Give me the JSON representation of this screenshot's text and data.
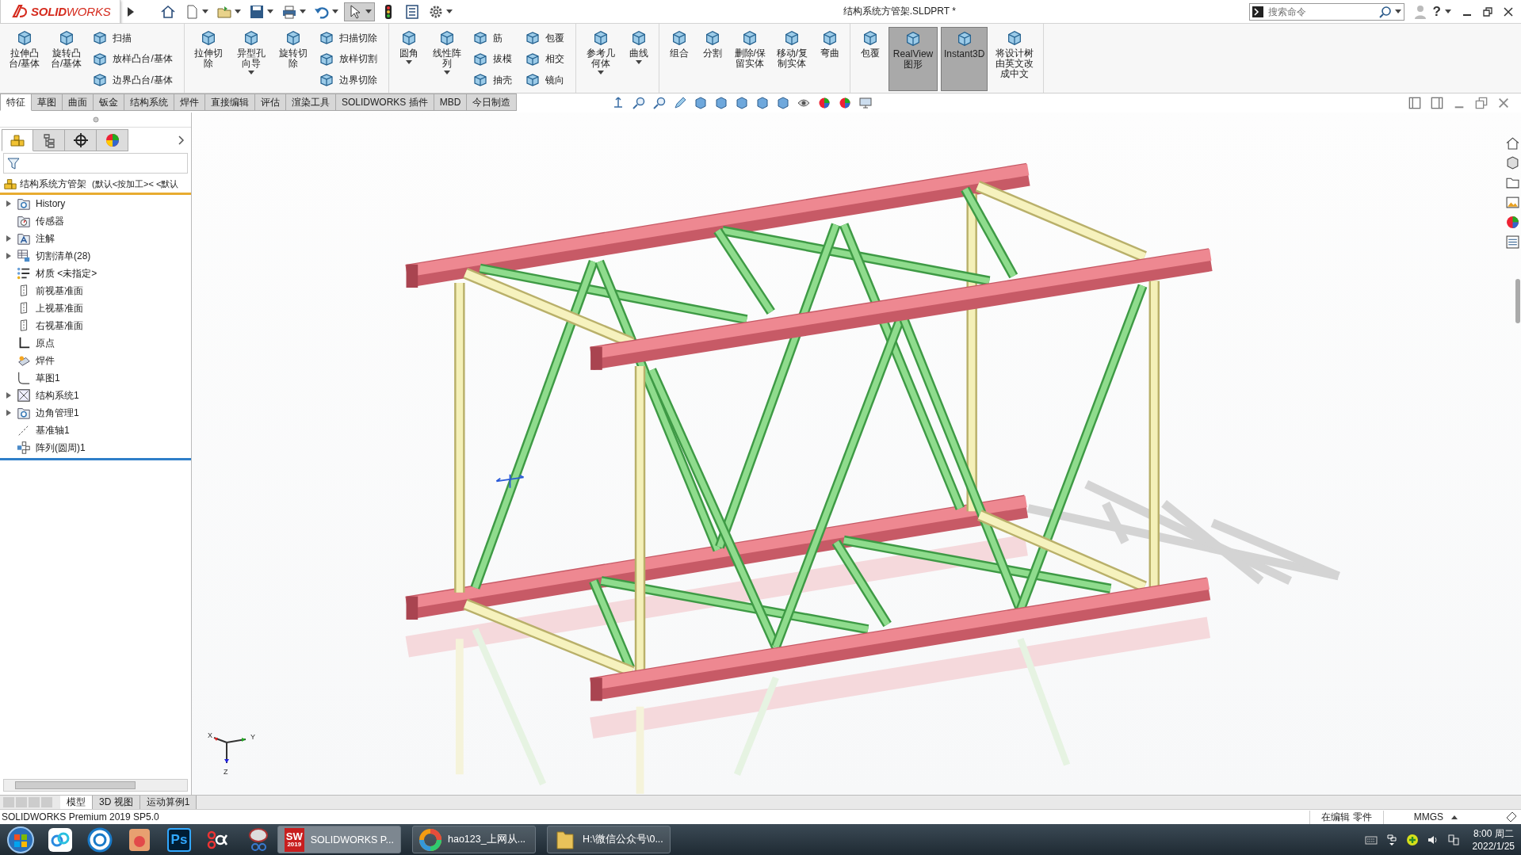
{
  "window": {
    "title": "结构系统方管架.SLDPRT *",
    "logo": "**SOLID**WORKS",
    "help": "?"
  },
  "quick_access": [
    {
      "kind": "home",
      "has_menu": false,
      "selected": false
    },
    {
      "kind": "new",
      "has_menu": true,
      "selected": false
    },
    {
      "kind": "open",
      "has_menu": true,
      "selected": false
    },
    {
      "kind": "save",
      "has_menu": true,
      "selected": false
    },
    {
      "kind": "print",
      "has_menu": true,
      "selected": false
    },
    {
      "kind": "undo",
      "has_menu": true,
      "selected": false
    },
    {
      "kind": "select",
      "has_menu": true,
      "selected": true
    },
    {
      "kind": "rebuild",
      "has_menu": false,
      "selected": false
    },
    {
      "kind": "properties",
      "has_menu": false,
      "selected": false
    },
    {
      "kind": "options",
      "has_menu": true,
      "selected": false
    }
  ],
  "search": {
    "placeholder": "搜索命令"
  },
  "ribbon": {
    "groups": [
      {
        "items": [
          {
            "kind": "large",
            "label": "拉伸凸台/基体",
            "has_menu": false,
            "selected": false
          },
          {
            "kind": "large",
            "label": "旋转凸台/基体",
            "has_menu": false,
            "selected": false
          },
          {
            "kind": "stack",
            "items": [
              {
                "label": "扫描",
                "selected": false
              },
              {
                "label": "放样凸台/基体",
                "selected": false
              },
              {
                "label": "边界凸台/基体",
                "selected": false
              }
            ]
          }
        ]
      },
      {
        "items": [
          {
            "kind": "large",
            "label": "拉伸切除",
            "has_menu": false,
            "selected": false
          },
          {
            "kind": "large",
            "label": "异型孔向导",
            "has_menu": true,
            "selected": false
          },
          {
            "kind": "large",
            "label": "旋转切除",
            "has_menu": false,
            "selected": false
          },
          {
            "kind": "stack",
            "items": [
              {
                "label": "扫描切除",
                "selected": false
              },
              {
                "label": "放样切割",
                "selected": false
              },
              {
                "label": "边界切除",
                "selected": false
              }
            ]
          }
        ]
      },
      {
        "items": [
          {
            "kind": "large",
            "label": "圆角",
            "has_menu": true,
            "selected": false
          },
          {
            "kind": "large",
            "label": "线性阵列",
            "has_menu": true,
            "selected": false
          },
          {
            "kind": "stack",
            "items": [
              {
                "label": "筋",
                "selected": false
              },
              {
                "label": "拔模",
                "selected": false
              },
              {
                "label": "抽壳",
                "selected": false
              }
            ]
          },
          {
            "kind": "stack",
            "items": [
              {
                "label": "包覆",
                "selected": false
              },
              {
                "label": "相交",
                "selected": false
              },
              {
                "label": "镜向",
                "selected": false
              }
            ]
          }
        ]
      },
      {
        "items": [
          {
            "kind": "large",
            "label": "参考几何体",
            "has_menu": true,
            "selected": false
          },
          {
            "kind": "large",
            "label": "曲线",
            "has_menu": true,
            "selected": false
          }
        ]
      },
      {
        "items": [
          {
            "kind": "large",
            "label": "组合",
            "has_menu": false,
            "selected": false
          },
          {
            "kind": "large",
            "label": "分割",
            "has_menu": false,
            "selected": false
          },
          {
            "kind": "large",
            "label": "删除/保留实体",
            "has_menu": false,
            "selected": false
          },
          {
            "kind": "large",
            "label": "移动/复制实体",
            "has_menu": false,
            "selected": false
          },
          {
            "kind": "large",
            "label": "弯曲",
            "has_menu": false,
            "selected": false
          }
        ]
      },
      {
        "items": [
          {
            "kind": "large",
            "label": "包覆",
            "has_menu": false,
            "selected": false
          },
          {
            "kind": "large",
            "label": "RealView 图形",
            "has_menu": false,
            "selected": true
          },
          {
            "kind": "large",
            "label": "Instant3D",
            "has_menu": false,
            "selected": true
          },
          {
            "kind": "large",
            "label": "将设计树由英文改成中文",
            "has_menu": false,
            "selected": false
          }
        ]
      }
    ]
  },
  "doc_tabs": [
    {
      "label": "特征",
      "selected": true
    },
    {
      "label": "草图",
      "selected": false
    },
    {
      "label": "曲面",
      "selected": false
    },
    {
      "label": "钣金",
      "selected": false
    },
    {
      "label": "结构系统",
      "selected": false
    },
    {
      "label": "焊件",
      "selected": false
    },
    {
      "label": "直接编辑",
      "selected": false
    },
    {
      "label": "评估",
      "selected": false
    },
    {
      "label": "渲染工具",
      "selected": false
    },
    {
      "label": "SOLIDWORKS 插件",
      "selected": false
    },
    {
      "label": "MBD",
      "selected": false
    },
    {
      "label": "今日制造",
      "selected": false
    }
  ],
  "panel_tabs": [
    {
      "kind": "features",
      "selected": true
    },
    {
      "kind": "properties",
      "selected": false
    },
    {
      "kind": "configurations",
      "selected": false
    },
    {
      "kind": "display",
      "selected": false
    }
  ],
  "feature_tree": {
    "root": {
      "name": "结构系统方管架",
      "config": "(默认<按加工>< <默认"
    },
    "items": [
      {
        "label": "History",
        "kind": "history",
        "expandable": true
      },
      {
        "label": "传感器",
        "kind": "sensor",
        "expandable": false
      },
      {
        "label": "注解",
        "kind": "annotation",
        "expandable": true
      },
      {
        "label": "切割清单(28)",
        "kind": "cutlist",
        "expandable": true
      },
      {
        "label": "材质 <未指定>",
        "kind": "material",
        "expandable": false
      },
      {
        "label": "前视基准面",
        "kind": "plane",
        "expandable": false
      },
      {
        "label": "上视基准面",
        "kind": "plane",
        "expandable": false
      },
      {
        "label": "右视基准面",
        "kind": "plane",
        "expandable": false
      },
      {
        "label": "原点",
        "kind": "origin",
        "expandable": false
      },
      {
        "label": "焊件",
        "kind": "weldment",
        "expandable": false
      },
      {
        "label": "草图1",
        "kind": "sketch",
        "expandable": false
      },
      {
        "label": "结构系统1",
        "kind": "structure",
        "expandable": true
      },
      {
        "label": "边角管理1",
        "kind": "corner",
        "expandable": true
      },
      {
        "label": "基准轴1",
        "kind": "axis",
        "expandable": false
      },
      {
        "label": "阵列(圆周)1",
        "kind": "pattern",
        "expandable": false
      }
    ]
  },
  "viewport": {
    "triad": {
      "x": "X",
      "y": "Y",
      "z": "Z"
    }
  },
  "bottom_tabs": [
    {
      "label": "模型",
      "selected": true
    },
    {
      "label": "3D 视图",
      "selected": false
    },
    {
      "label": "运动算例1",
      "selected": false
    }
  ],
  "status_bar": {
    "product": "SOLIDWORKS Premium 2019 SP5.0",
    "mode": "在编辑 零件",
    "units": "MMGS"
  },
  "taskbar": {
    "pinned": [
      {
        "kind": "start"
      },
      {
        "kind": "cloud"
      },
      {
        "kind": "aperture"
      },
      {
        "kind": "album"
      },
      {
        "kind": "photoshop",
        "text": "Ps"
      },
      {
        "kind": "recorder"
      },
      {
        "kind": "scissors"
      }
    ],
    "windows": [
      {
        "kind": "solidworks",
        "label": "SOLIDWORKS P...",
        "icon_text": "SW",
        "icon_badge": "2019",
        "selected": true
      },
      {
        "kind": "browser",
        "label": "hao123_上网从...",
        "selected": false
      },
      {
        "kind": "folder",
        "label": "H:\\微信公众号\\0...",
        "selected": false
      }
    ],
    "clock": {
      "time": "8:00 周二",
      "date": "2022/1/25"
    }
  }
}
